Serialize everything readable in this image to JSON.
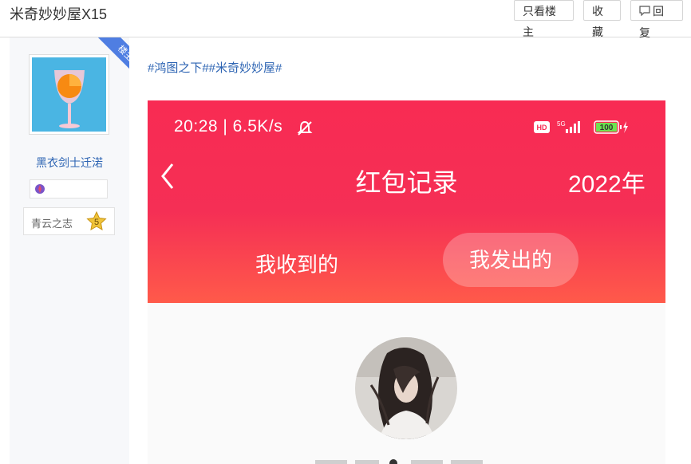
{
  "thread": {
    "title": "米奇妙妙屋X15"
  },
  "toolbar": {
    "only_op": "只看楼主",
    "favorite": "收藏",
    "reply": "回复"
  },
  "author": {
    "ribbon": "楼主",
    "username": "黑衣剑士迁渃",
    "level_name": "青云之志",
    "level_number": "5"
  },
  "post": {
    "topic": "#鸿图之下##米奇妙妙屋#",
    "screenshot": {
      "status_time": "20:28 | 6.5K/s",
      "battery": "100",
      "network": "5G",
      "hd": "HD",
      "page_title": "红包记录",
      "year": "2022年",
      "tab_received": "我收到的",
      "tab_sent": "我发出的"
    }
  },
  "colors": {
    "link": "#2d64b3",
    "app_red": "#f82b53",
    "ribbon": "#4f7ee2"
  }
}
